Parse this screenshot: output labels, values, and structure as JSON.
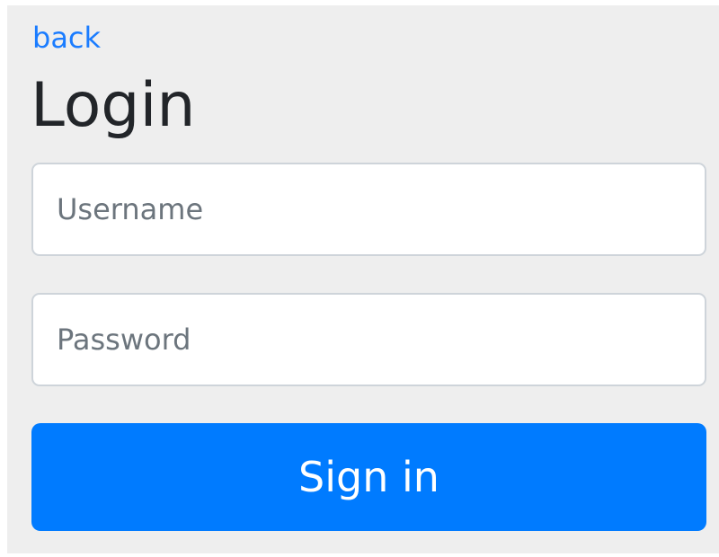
{
  "nav": {
    "back_label": "back"
  },
  "form": {
    "title": "Login",
    "username": {
      "value": "",
      "placeholder": "Username"
    },
    "password": {
      "value": "",
      "placeholder": "Password"
    },
    "submit_label": "Sign in"
  },
  "colors": {
    "background": "#eeeeee",
    "link": "#1a7cff",
    "primary_button": "#007bff",
    "input_border": "#ced4da"
  }
}
